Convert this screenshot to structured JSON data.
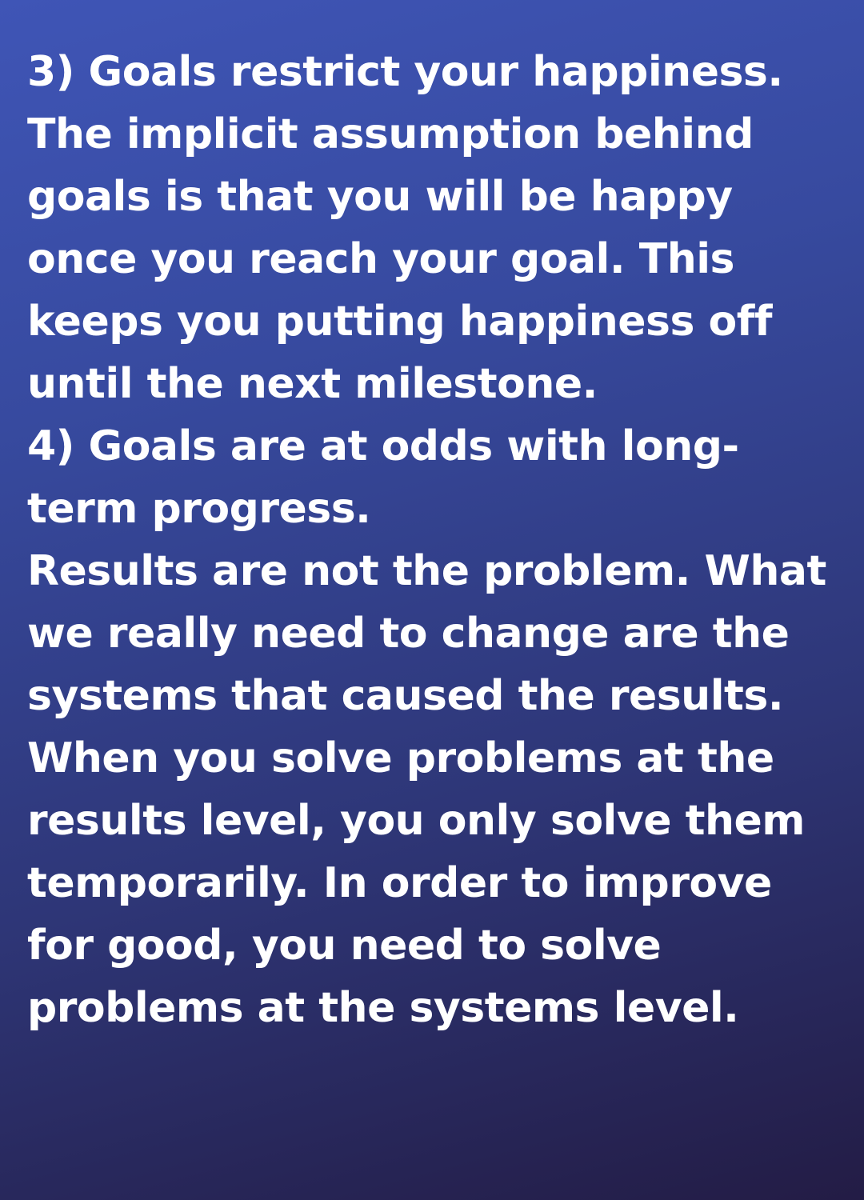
{
  "content": {
    "lines": [
      "3) Goals restrict your happiness.",
      "The implicit assumption behind",
      "goals is that you will be happy",
      "once you reach your goal. This",
      "keeps you putting happiness off",
      "until the next milestone.",
      "4) Goals are at odds with long-",
      "term progress.",
      "Results are not the problem. What",
      "we really need to change are the",
      "systems that caused the results.",
      "When you solve problems at the",
      "results level, you only solve them",
      "temporarily. In order to improve",
      "for good, you need to solve",
      "problems at the systems level."
    ]
  },
  "colors": {
    "text": "#ffffff",
    "gradient_top": "#3f55b6",
    "gradient_bottom": "#231c45"
  }
}
